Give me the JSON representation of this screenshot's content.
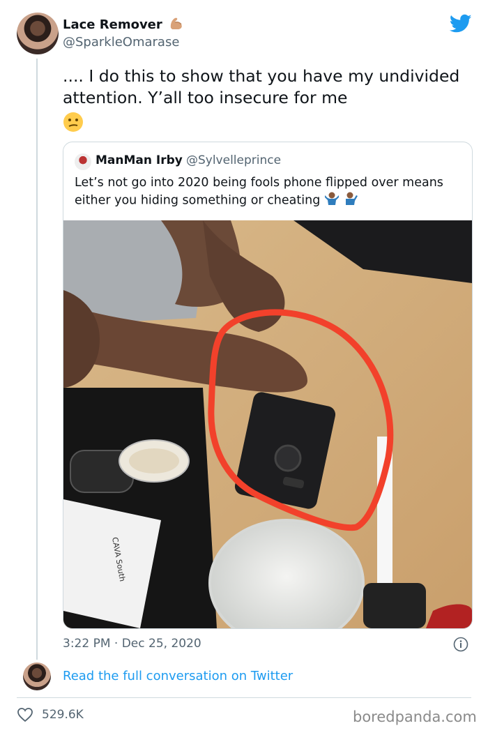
{
  "tweet": {
    "author_name": "Lace Remover",
    "author_name_emoji": "flexed-biceps-emoji",
    "author_handle": "@SparkleOmarase",
    "text": ".... I do this to show that you have my undivided attention. Y’all too insecure for me",
    "text_emoji": "confused-face-emoji",
    "timestamp": "3:22 PM · Dec 25, 2020",
    "read_more_label": "Read the full conversation on Twitter",
    "like_count": "529.6K"
  },
  "quoted_tweet": {
    "author_name": "ManMan Irby",
    "author_handle": "@Sylvelleprince",
    "text": "Let’s not go into 2020 being fools phone flipped over means either you hiding something or cheating",
    "text_emojis": [
      "man-shrugging-emoji",
      "man-tipping-hand-emoji"
    ],
    "photo_receipt_text": "CAVA South"
  },
  "watermark": "boredpanda.com",
  "colors": {
    "twitter_blue": "#1d9bf0",
    "annotation_red": "#f2412b",
    "secondary_text": "#536471",
    "border": "#cfd9de"
  }
}
